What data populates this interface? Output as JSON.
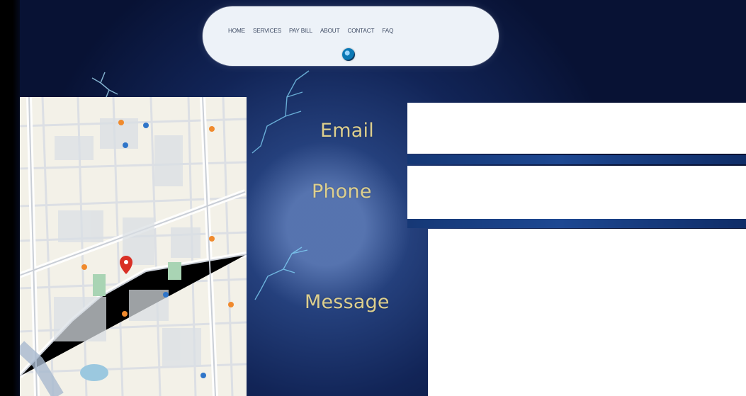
{
  "navigation": {
    "items": [
      "HOME",
      "SERVICES",
      "PAY BILL",
      "ABOUT",
      "CONTACT",
      "FAQ"
    ],
    "logo_icon": "circular-brand-icon"
  },
  "contact_form": {
    "email_label": "Email",
    "phone_label": "Phone",
    "message_label": "Message",
    "email_value": "",
    "phone_value": "",
    "message_value": ""
  },
  "map": {
    "icon": "location-pin-icon"
  },
  "colors": {
    "background": "#0b1b46",
    "label": "#ddcf8e",
    "nav_text": "#3d4a63",
    "field": "#ffffff"
  }
}
